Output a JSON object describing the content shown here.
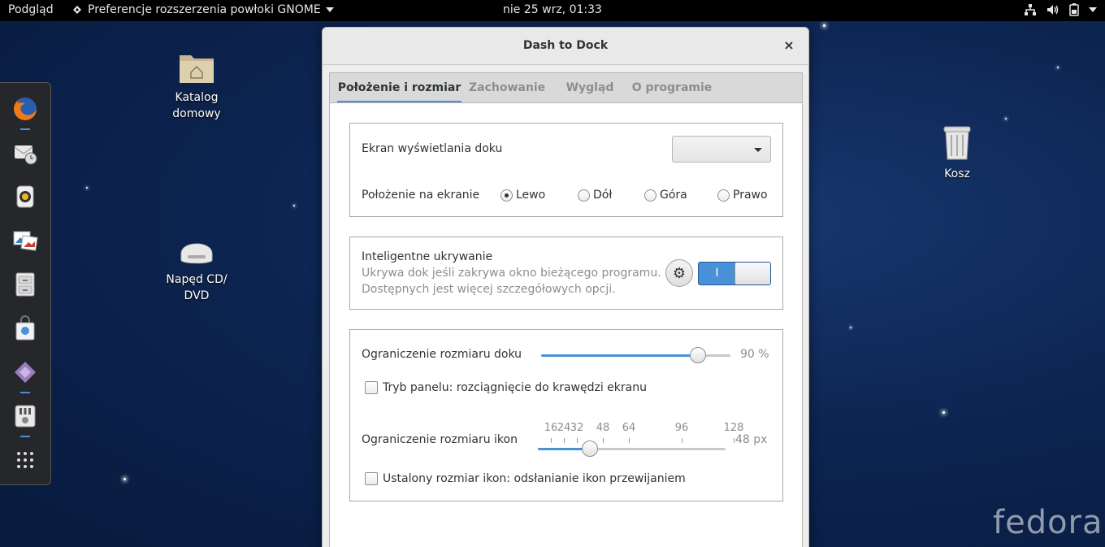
{
  "topbar": {
    "activities": "Podgląd",
    "app_menu": "Preferencje rozszerzenia powłoki GNOME",
    "clock": "nie 25 wrz, 01:33",
    "status_icons": [
      "network-icon",
      "volume-icon",
      "battery-icon",
      "chevron-down-icon"
    ]
  },
  "dock": {
    "items": [
      {
        "name": "firefox-icon",
        "running": true
      },
      {
        "name": "mail-clock-icon",
        "running": false
      },
      {
        "name": "rhythmbox-icon",
        "running": false
      },
      {
        "name": "photos-icon",
        "running": false
      },
      {
        "name": "files-cabinet-icon",
        "running": false
      },
      {
        "name": "software-bag-icon",
        "running": false
      },
      {
        "name": "extensions-icon",
        "running": true
      },
      {
        "name": "tweaks-icon",
        "running": true
      },
      {
        "name": "show-apps-icon",
        "running": false
      }
    ]
  },
  "desktop": {
    "home": "Katalog domowy",
    "cd": "Napęd CD/ DVD",
    "trash": "Kosz",
    "watermark": "fedora"
  },
  "window": {
    "title": "Dash to Dock",
    "close": "×",
    "tabs": [
      "Położenie i rozmiar",
      "Zachowanie",
      "Wygląd",
      "O programie"
    ],
    "active_tab": 0,
    "position": {
      "monitor_label": "Ekran wyświetlania doku",
      "monitor_value": "",
      "position_label": "Położenie na ekranie",
      "options": [
        "Lewo",
        "Dół",
        "Góra",
        "Prawo"
      ],
      "selected": "Lewo"
    },
    "autohide": {
      "title": "Inteligentne ukrywanie",
      "desc1": "Ukrywa dok jeśli zakrywa okno bieżącego programu.",
      "desc2": "Dostępnych jest więcej szczegółowych opcji.",
      "settings_icon": "gear-icon",
      "switch_on_label": "I",
      "enabled": true
    },
    "size": {
      "dock_size_label": "Ograniczenie rozmiaru doku",
      "dock_size_value": "90 %",
      "dock_size_fraction": 0.9,
      "panel_mode_label": "Tryb panelu: rozciągnięcie do krawędzi ekranu",
      "panel_mode_checked": false,
      "icon_size_label": "Ograniczenie rozmiaru ikon",
      "icon_size_value": "48 px",
      "icon_size_current": 48,
      "icon_size_min": 16,
      "icon_size_max": 128,
      "icon_marks": [
        "16",
        "24",
        "32",
        "48",
        "64",
        "96",
        "128"
      ],
      "fixed_size_label": "Ustalony rozmiar ikon: odsłanianie ikon przewijaniem",
      "fixed_size_checked": false
    }
  }
}
